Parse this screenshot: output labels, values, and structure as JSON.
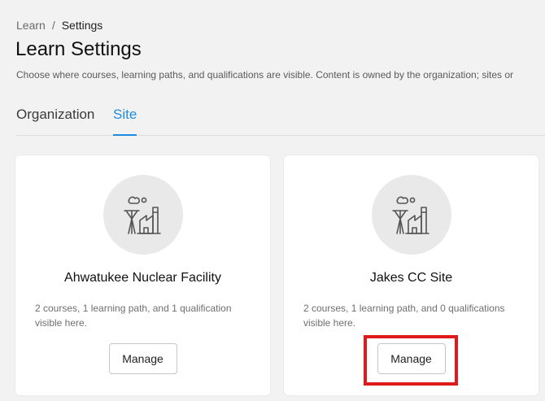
{
  "breadcrumb": {
    "parent": "Learn",
    "separator": "/",
    "current": "Settings"
  },
  "page": {
    "title": "Learn Settings",
    "description": "Choose where courses, learning paths, and qualifications are visible. Content is owned by the organization; sites or"
  },
  "tabs": [
    {
      "label": "Organization",
      "active": false
    },
    {
      "label": "Site",
      "active": true
    }
  ],
  "colors": {
    "accent": "#1f8ce0",
    "highlight": "#e01a1a",
    "background": "#f2f2f2"
  },
  "sites": [
    {
      "name": "Ahwatukee Nuclear Facility",
      "summary": "2 courses, 1 learning path, and 1 qualification visible here.",
      "icon": "factory-icon",
      "button_label": "Manage"
    },
    {
      "name": "Jakes CC Site",
      "summary": "2 courses, 1 learning path, and 0 qualifications visible here.",
      "icon": "factory-icon",
      "button_label": "Manage"
    }
  ]
}
